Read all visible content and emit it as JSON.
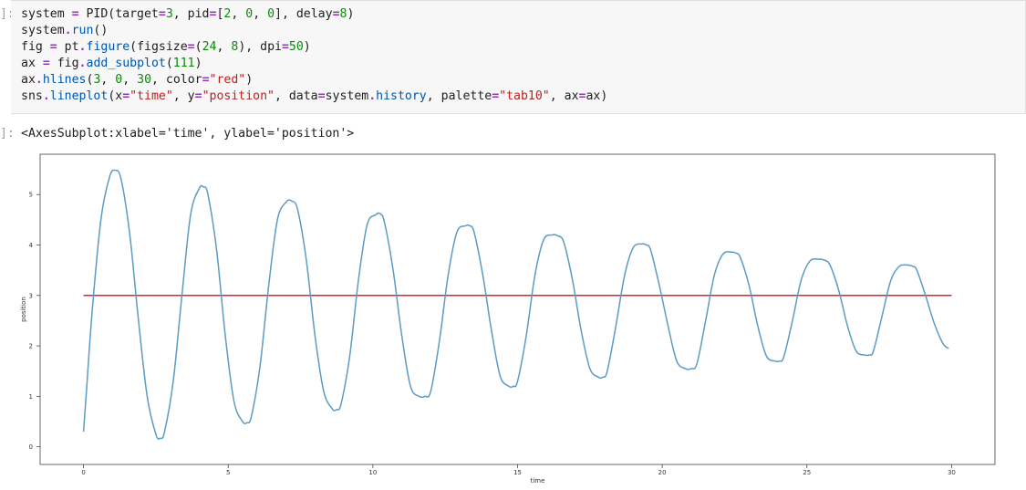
{
  "cell_in": {
    "prompt": "]:",
    "lines": [
      [
        [
          "system ",
          "tok-plain"
        ],
        [
          "=",
          "tok-op"
        ],
        [
          " PID(target",
          "tok-plain"
        ],
        [
          "=",
          "tok-op"
        ],
        [
          "3",
          "tok-num"
        ],
        [
          ", pid",
          "tok-plain"
        ],
        [
          "=",
          "tok-op"
        ],
        [
          "[",
          "tok-plain"
        ],
        [
          "2",
          "tok-num"
        ],
        [
          ", ",
          "tok-plain"
        ],
        [
          "0",
          "tok-num"
        ],
        [
          ", ",
          "tok-plain"
        ],
        [
          "0",
          "tok-num"
        ],
        [
          "], delay",
          "tok-plain"
        ],
        [
          "=",
          "tok-op"
        ],
        [
          "8",
          "tok-num"
        ],
        [
          ")",
          "tok-plain"
        ]
      ],
      [
        [
          "system",
          "tok-plain"
        ],
        [
          ".",
          "tok-op"
        ],
        [
          "run",
          "tok-fn"
        ],
        [
          "()",
          "tok-plain"
        ]
      ],
      [
        [
          "fig ",
          "tok-plain"
        ],
        [
          "=",
          "tok-op"
        ],
        [
          " pt",
          "tok-plain"
        ],
        [
          ".",
          "tok-op"
        ],
        [
          "figure",
          "tok-fn"
        ],
        [
          "(figsize",
          "tok-plain"
        ],
        [
          "=",
          "tok-op"
        ],
        [
          "(",
          "tok-plain"
        ],
        [
          "24",
          "tok-num"
        ],
        [
          ", ",
          "tok-plain"
        ],
        [
          "8",
          "tok-num"
        ],
        [
          "), dpi",
          "tok-plain"
        ],
        [
          "=",
          "tok-op"
        ],
        [
          "50",
          "tok-num"
        ],
        [
          ")",
          "tok-plain"
        ]
      ],
      [
        [
          "ax ",
          "tok-plain"
        ],
        [
          "=",
          "tok-op"
        ],
        [
          " fig",
          "tok-plain"
        ],
        [
          ".",
          "tok-op"
        ],
        [
          "add_subplot",
          "tok-fn"
        ],
        [
          "(",
          "tok-plain"
        ],
        [
          "111",
          "tok-num"
        ],
        [
          ")",
          "tok-plain"
        ]
      ],
      [
        [
          "ax",
          "tok-plain"
        ],
        [
          ".",
          "tok-op"
        ],
        [
          "hlines",
          "tok-fn"
        ],
        [
          "(",
          "tok-plain"
        ],
        [
          "3",
          "tok-num"
        ],
        [
          ", ",
          "tok-plain"
        ],
        [
          "0",
          "tok-num"
        ],
        [
          ", ",
          "tok-plain"
        ],
        [
          "30",
          "tok-num"
        ],
        [
          ", color",
          "tok-plain"
        ],
        [
          "=",
          "tok-op"
        ],
        [
          "\"red\"",
          "tok-str"
        ],
        [
          ")",
          "tok-plain"
        ]
      ],
      [
        [
          "sns",
          "tok-plain"
        ],
        [
          ".",
          "tok-op"
        ],
        [
          "lineplot",
          "tok-fn"
        ],
        [
          "(x",
          "tok-plain"
        ],
        [
          "=",
          "tok-op"
        ],
        [
          "\"time\"",
          "tok-str"
        ],
        [
          ", y",
          "tok-plain"
        ],
        [
          "=",
          "tok-op"
        ],
        [
          "\"position\"",
          "tok-str"
        ],
        [
          ", data",
          "tok-plain"
        ],
        [
          "=",
          "tok-op"
        ],
        [
          "system",
          "tok-plain"
        ],
        [
          ".",
          "tok-op"
        ],
        [
          "history",
          "tok-fn"
        ],
        [
          ", palette",
          "tok-plain"
        ],
        [
          "=",
          "tok-op"
        ],
        [
          "\"tab10\"",
          "tok-str"
        ],
        [
          ", ax",
          "tok-plain"
        ],
        [
          "=",
          "tok-op"
        ],
        [
          "ax)",
          "tok-plain"
        ]
      ]
    ]
  },
  "cell_out": {
    "prompt": "]:",
    "text": "<AxesSubplot:xlabel='time', ylabel='position'>"
  },
  "chart_data": {
    "type": "line",
    "xlabel": "time",
    "ylabel": "position",
    "xlim": [
      -1.5,
      31.5
    ],
    "ylim": [
      -0.35,
      5.8
    ],
    "xticks": [
      0,
      5,
      10,
      15,
      20,
      25,
      30
    ],
    "yticks": [
      0,
      1,
      2,
      3,
      4,
      5
    ],
    "series": [
      {
        "kind": "hline",
        "color": "#d62728",
        "y": 3,
        "x_range": [
          0,
          30
        ]
      },
      {
        "kind": "line",
        "color": "#5b9bc4",
        "x": [
          0,
          0.1,
          0.3,
          0.6,
          0.9,
          1.1,
          1.3,
          1.6,
          1.9,
          2.2,
          2.5,
          2.65,
          2.8,
          3.1,
          3.4,
          3.7,
          4.0,
          4.15,
          4.3,
          4.6,
          4.9,
          5.2,
          5.5,
          5.65,
          5.8,
          6.1,
          6.4,
          6.7,
          7.0,
          7.2,
          7.4,
          7.7,
          8.0,
          8.3,
          8.6,
          8.75,
          8.9,
          9.2,
          9.5,
          9.8,
          10.1,
          10.25,
          10.4,
          10.7,
          11.0,
          11.3,
          11.6,
          11.8,
          12.0,
          12.3,
          12.6,
          12.9,
          13.2,
          13.35,
          13.5,
          13.8,
          14.1,
          14.4,
          14.7,
          14.85,
          15.0,
          15.3,
          15.6,
          15.9,
          16.2,
          16.4,
          16.6,
          16.9,
          17.2,
          17.5,
          17.8,
          17.95,
          18.1,
          18.4,
          18.7,
          19.0,
          19.3,
          19.45,
          19.6,
          19.9,
          20.2,
          20.5,
          20.8,
          21.0,
          21.2,
          21.5,
          21.8,
          22.1,
          22.4,
          22.55,
          22.7,
          23.0,
          23.3,
          23.6,
          23.9,
          24.05,
          24.2,
          24.5,
          24.8,
          25.1,
          25.4,
          25.6,
          25.8,
          26.1,
          26.4,
          26.7,
          27.0,
          27.15,
          27.3,
          27.6,
          27.9,
          28.2,
          28.5,
          28.65,
          28.8,
          29.1,
          29.4,
          29.7,
          29.9
        ],
        "y": [
          0.3,
          1.1,
          2.7,
          4.5,
          5.35,
          5.48,
          5.3,
          4.2,
          2.5,
          1.0,
          0.25,
          0.17,
          0.3,
          1.3,
          3.0,
          4.6,
          5.12,
          5.15,
          5.0,
          3.9,
          2.2,
          0.9,
          0.5,
          0.48,
          0.6,
          1.6,
          3.2,
          4.5,
          4.85,
          4.87,
          4.7,
          3.7,
          2.2,
          1.1,
          0.75,
          0.74,
          0.85,
          1.8,
          3.3,
          4.4,
          4.6,
          4.62,
          4.45,
          3.5,
          2.2,
          1.2,
          1.0,
          1.0,
          1.1,
          2.1,
          3.4,
          4.25,
          4.38,
          4.38,
          4.25,
          3.4,
          2.3,
          1.4,
          1.2,
          1.2,
          1.3,
          2.2,
          3.4,
          4.1,
          4.2,
          4.18,
          4.05,
          3.3,
          2.3,
          1.55,
          1.38,
          1.38,
          1.5,
          2.4,
          3.4,
          3.95,
          4.02,
          4.0,
          3.9,
          3.2,
          2.4,
          1.7,
          1.55,
          1.55,
          1.65,
          2.5,
          3.4,
          3.82,
          3.86,
          3.84,
          3.75,
          3.2,
          2.4,
          1.8,
          1.7,
          1.7,
          1.78,
          2.5,
          3.3,
          3.68,
          3.72,
          3.7,
          3.6,
          3.1,
          2.4,
          1.9,
          1.82,
          1.82,
          1.9,
          2.6,
          3.3,
          3.58,
          3.6,
          3.58,
          3.5,
          3.0,
          2.45,
          2.05,
          1.95
        ]
      }
    ]
  }
}
